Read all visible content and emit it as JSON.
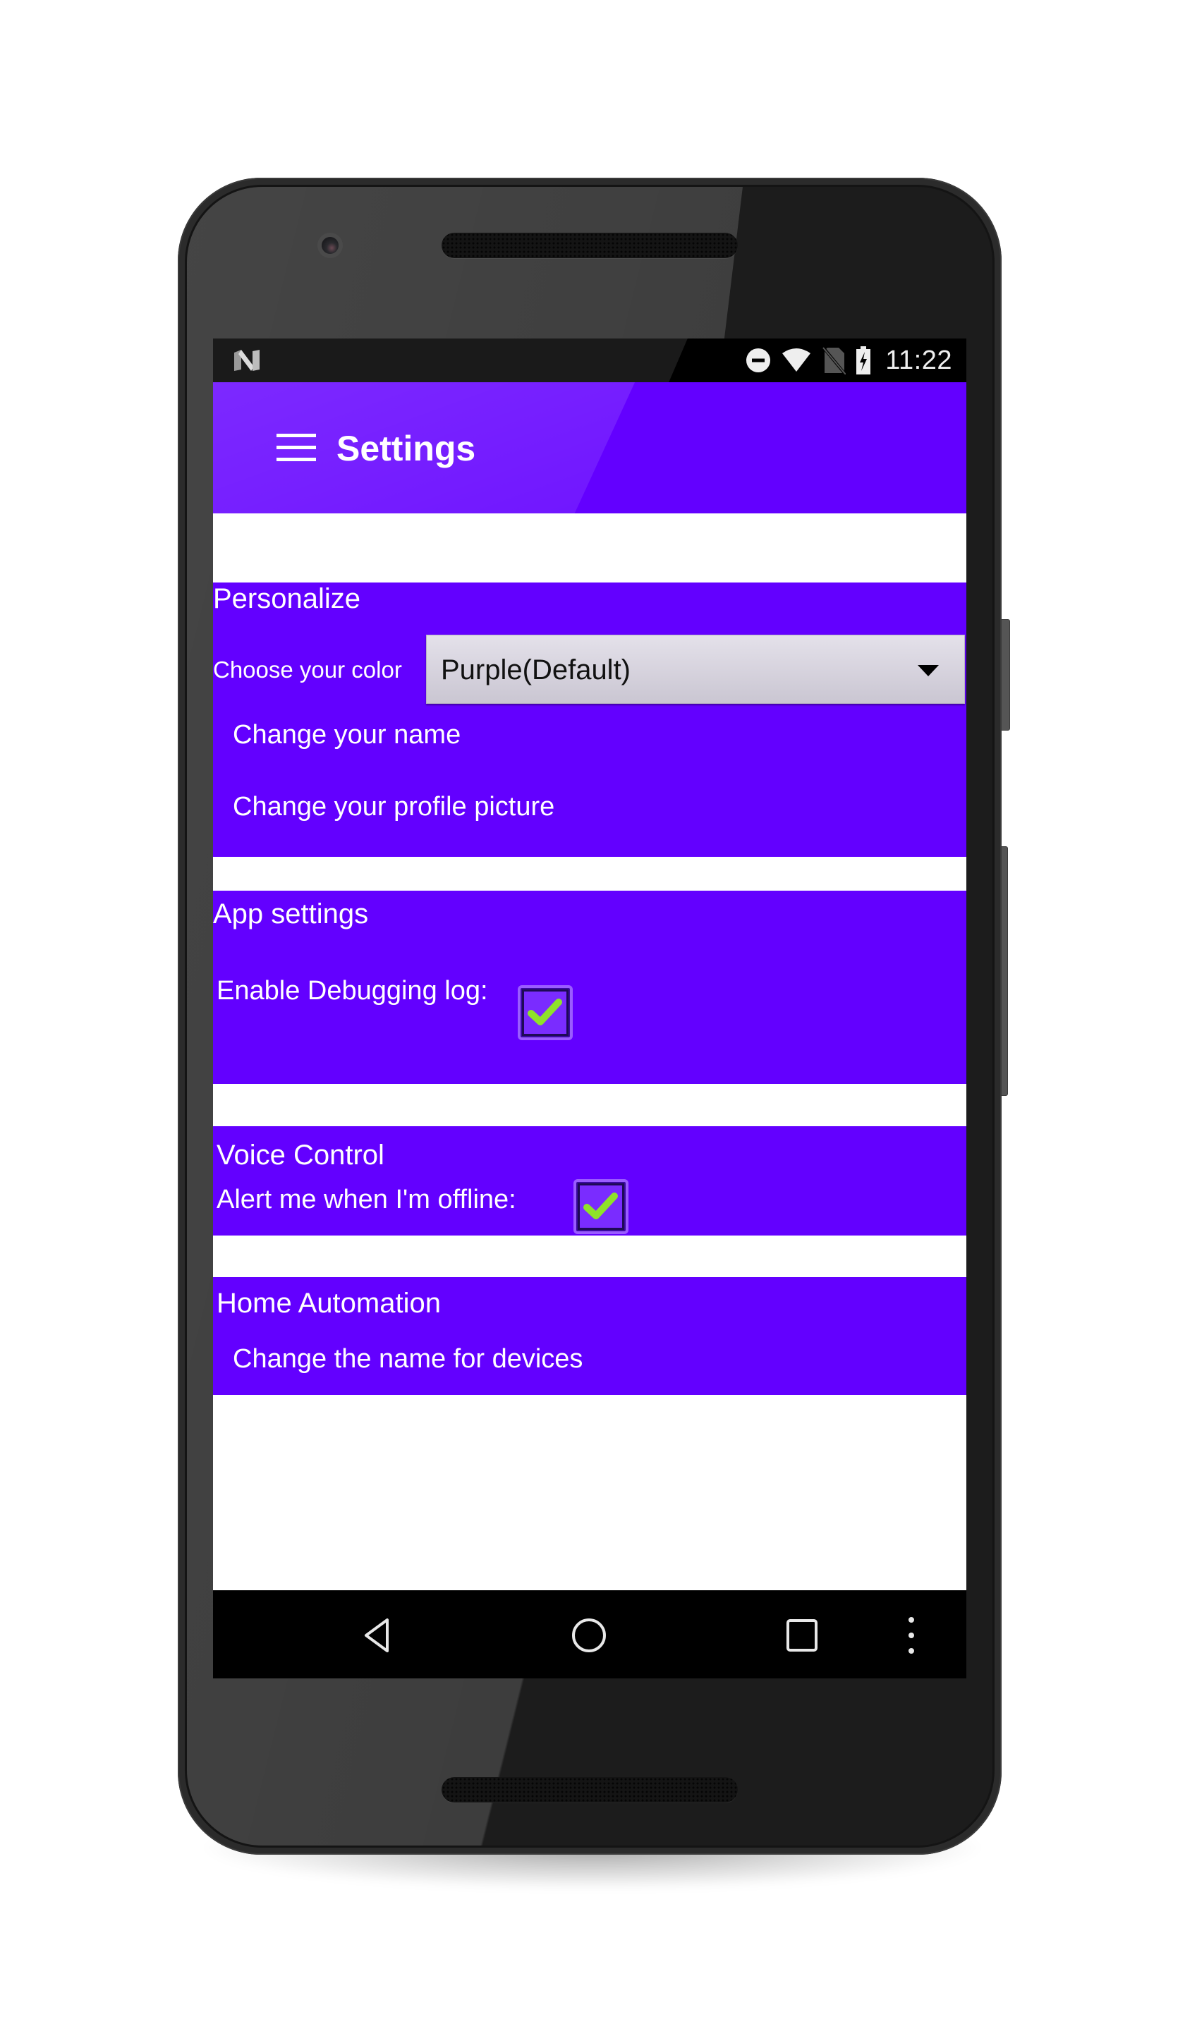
{
  "status_bar": {
    "left_icon": "android-n-logo-icon",
    "icons": [
      "do-not-disturb-icon",
      "wifi-icon",
      "no-sim-icon",
      "battery-charging-icon"
    ],
    "time": "11:22"
  },
  "app_bar": {
    "menu_icon": "hamburger-menu-icon",
    "title": "Settings"
  },
  "sections": {
    "personalize": {
      "title": "Personalize",
      "color_label": "Choose your color",
      "color_select": {
        "value": "Purple(Default)",
        "icon": "dropdown-arrow-icon"
      },
      "items": [
        {
          "label": "Change your name"
        },
        {
          "label": "Change your profile picture"
        }
      ]
    },
    "app_settings": {
      "title": "App settings",
      "debug_log": {
        "label": "Enable Debugging log:",
        "checked": true
      }
    },
    "voice_control": {
      "title": "Voice Control",
      "offline_alert": {
        "label": "Alert me when I'm offline:",
        "checked": true
      }
    },
    "home_automation": {
      "title": "Home Automation",
      "items": [
        {
          "label": "Change the name for devices"
        }
      ]
    }
  },
  "nav_bar": {
    "buttons": [
      "back-icon",
      "home-icon",
      "recents-icon",
      "overflow-menu-icon"
    ]
  },
  "colors": {
    "accent": "#6300ff",
    "checkbox_check": "#8fe22a",
    "dropdown_bg": "#d8d4de"
  }
}
